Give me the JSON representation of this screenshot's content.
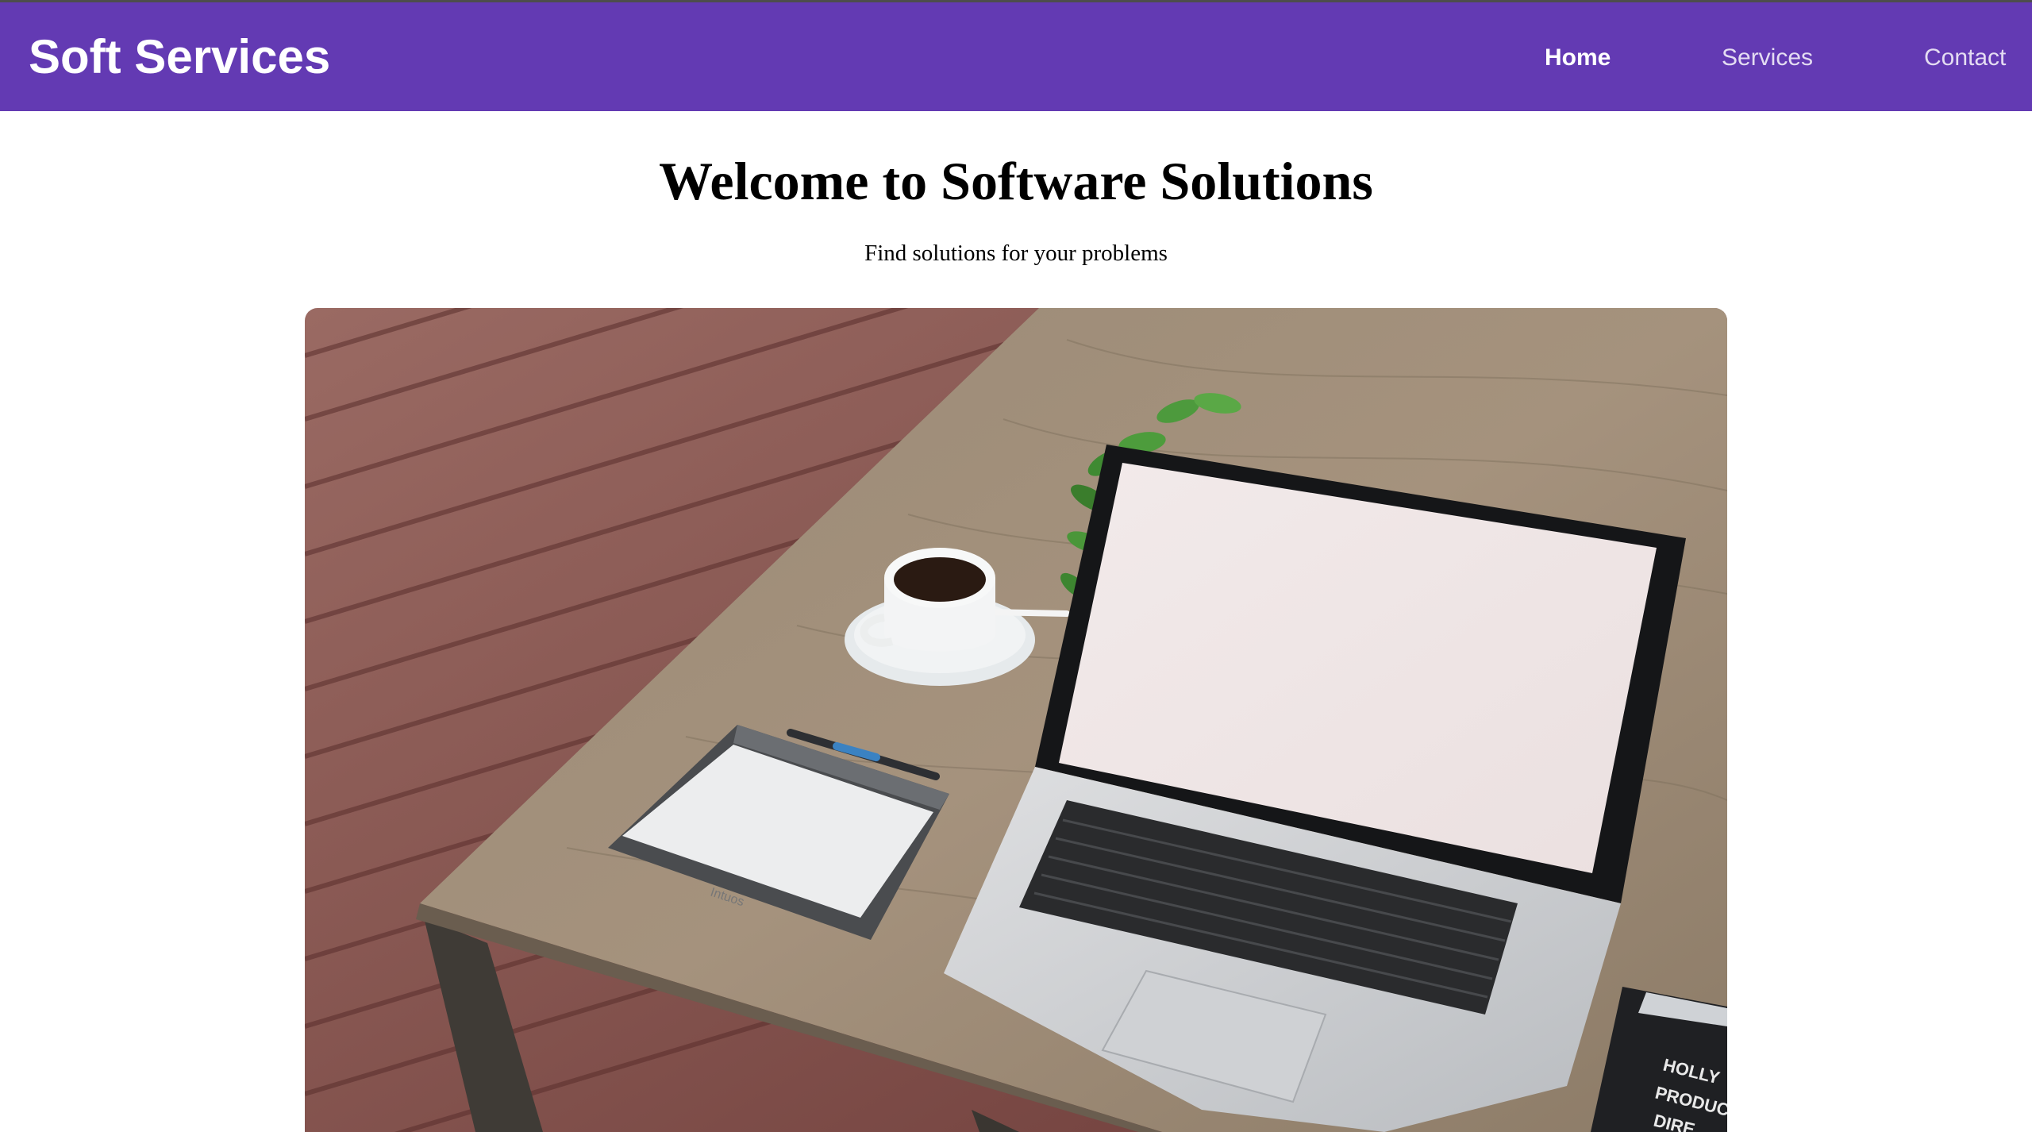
{
  "navbar": {
    "brand": "Soft Services",
    "links": [
      {
        "label": "Home",
        "active": true
      },
      {
        "label": "Services",
        "active": false
      },
      {
        "label": "Contact",
        "active": false
      }
    ],
    "background_color": "#633ab3"
  },
  "hero": {
    "title": "Welcome to Software Solutions",
    "subtitle": "Find solutions for your problems"
  },
  "image": {
    "stamp_text": [
      "HOLLY",
      "PRODUC",
      "DIRE"
    ],
    "tablet_brand": "Intuos"
  }
}
